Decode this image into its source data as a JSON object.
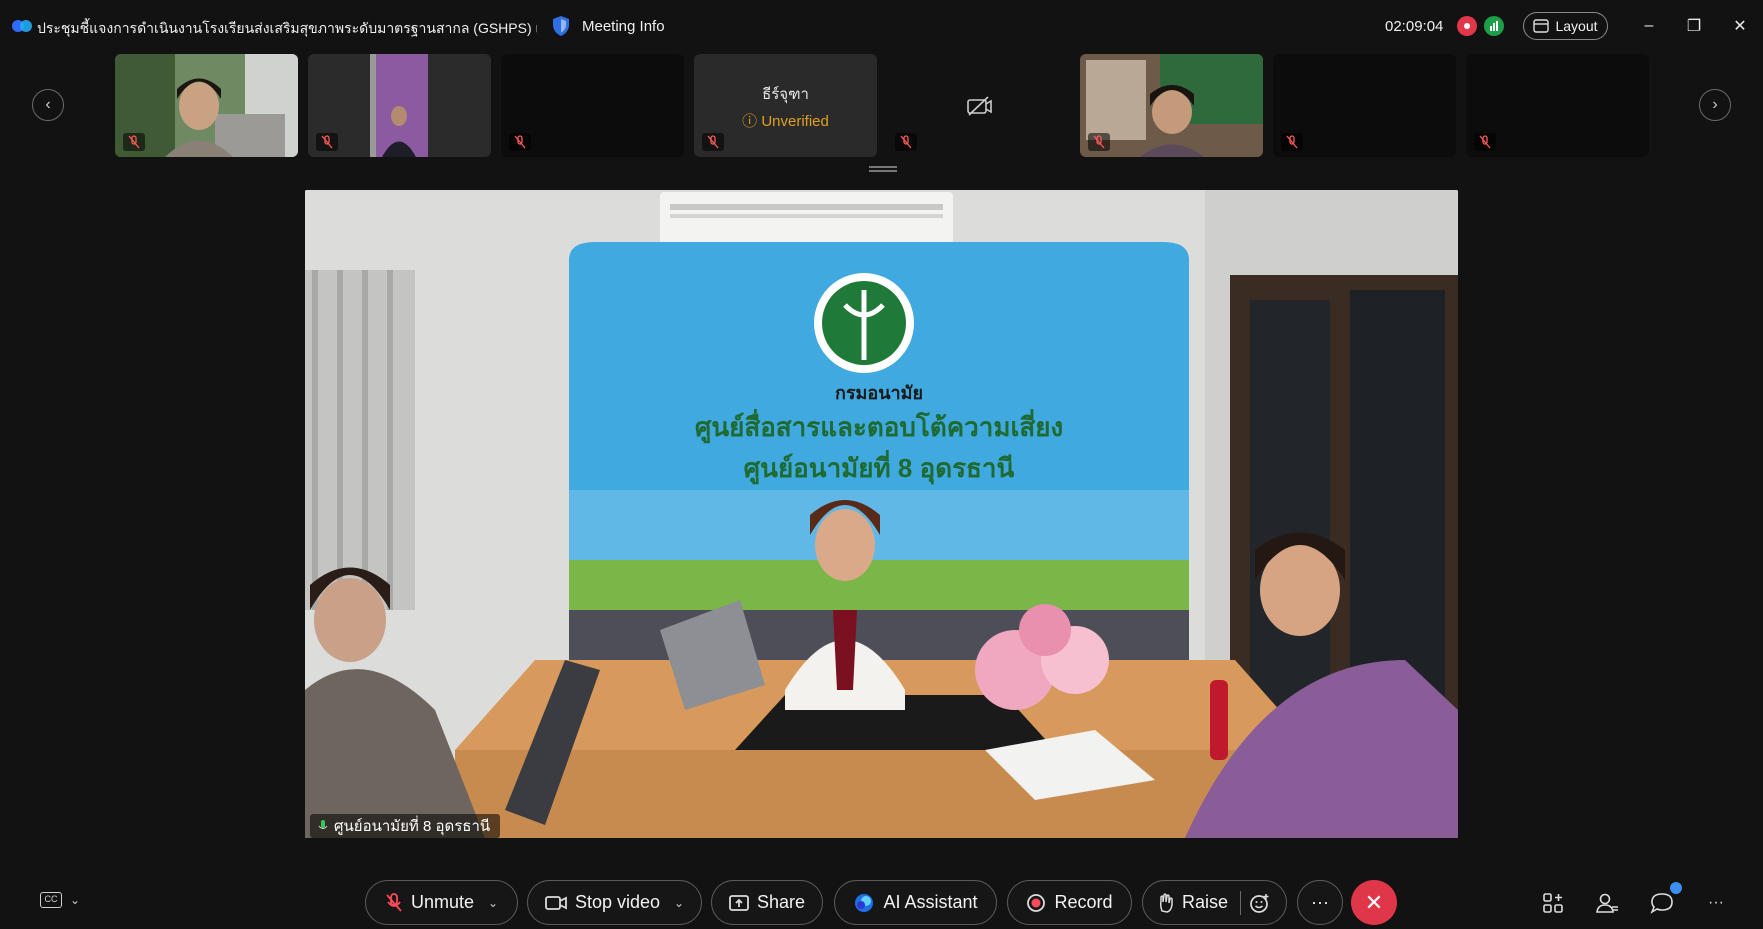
{
  "window": {
    "title": "ประชุมชี้แจงการดำเนินงานโรงเรียนส่งเสริมสุขภาพระดับมาตรฐานสากล (GSHPS) เข...",
    "meeting_info_label": "Meeting Info",
    "timer": "02:09:04",
    "layout_label": "Layout",
    "minimize": "–",
    "restore": "❐",
    "close": "✕"
  },
  "participants": [
    {
      "name": "",
      "status": "",
      "muted": true
    },
    {
      "name": "",
      "status": "",
      "muted": true
    },
    {
      "name": "",
      "status": "",
      "muted": true
    },
    {
      "name": "ธีร์จุฑา",
      "status": "Unverified",
      "muted": true
    },
    {
      "name": "",
      "status": "",
      "muted": true,
      "video_off": true
    },
    {
      "name": "",
      "status": "",
      "muted": true
    },
    {
      "name": "",
      "status": "",
      "muted": true
    },
    {
      "name": "",
      "status": "",
      "muted": true
    }
  ],
  "main_video": {
    "speaker_name": "ศูนย์อนามัยที่ 8 อุดรธานี",
    "banner_line1": "กรมอนามัย",
    "banner_line2": "ศูนย์สื่อสารและตอบโต้ความเสี่ยง",
    "banner_line3": "ศูนย์อนามัยที่ 8 อุดรธานี"
  },
  "toolbar": {
    "cc_label": "CC",
    "unmute_label": "Unmute",
    "stop_video_label": "Stop video",
    "share_label": "Share",
    "ai_assistant_label": "AI Assistant",
    "record_label": "Record",
    "raise_label": "Raise",
    "more_label": "···",
    "end_label": "✕"
  },
  "colors": {
    "background": "#121212",
    "record_red": "#e0384a",
    "end_call_red": "#e0364a",
    "unverified_amber": "#e0a020",
    "notify_blue": "#3a8ff0"
  }
}
